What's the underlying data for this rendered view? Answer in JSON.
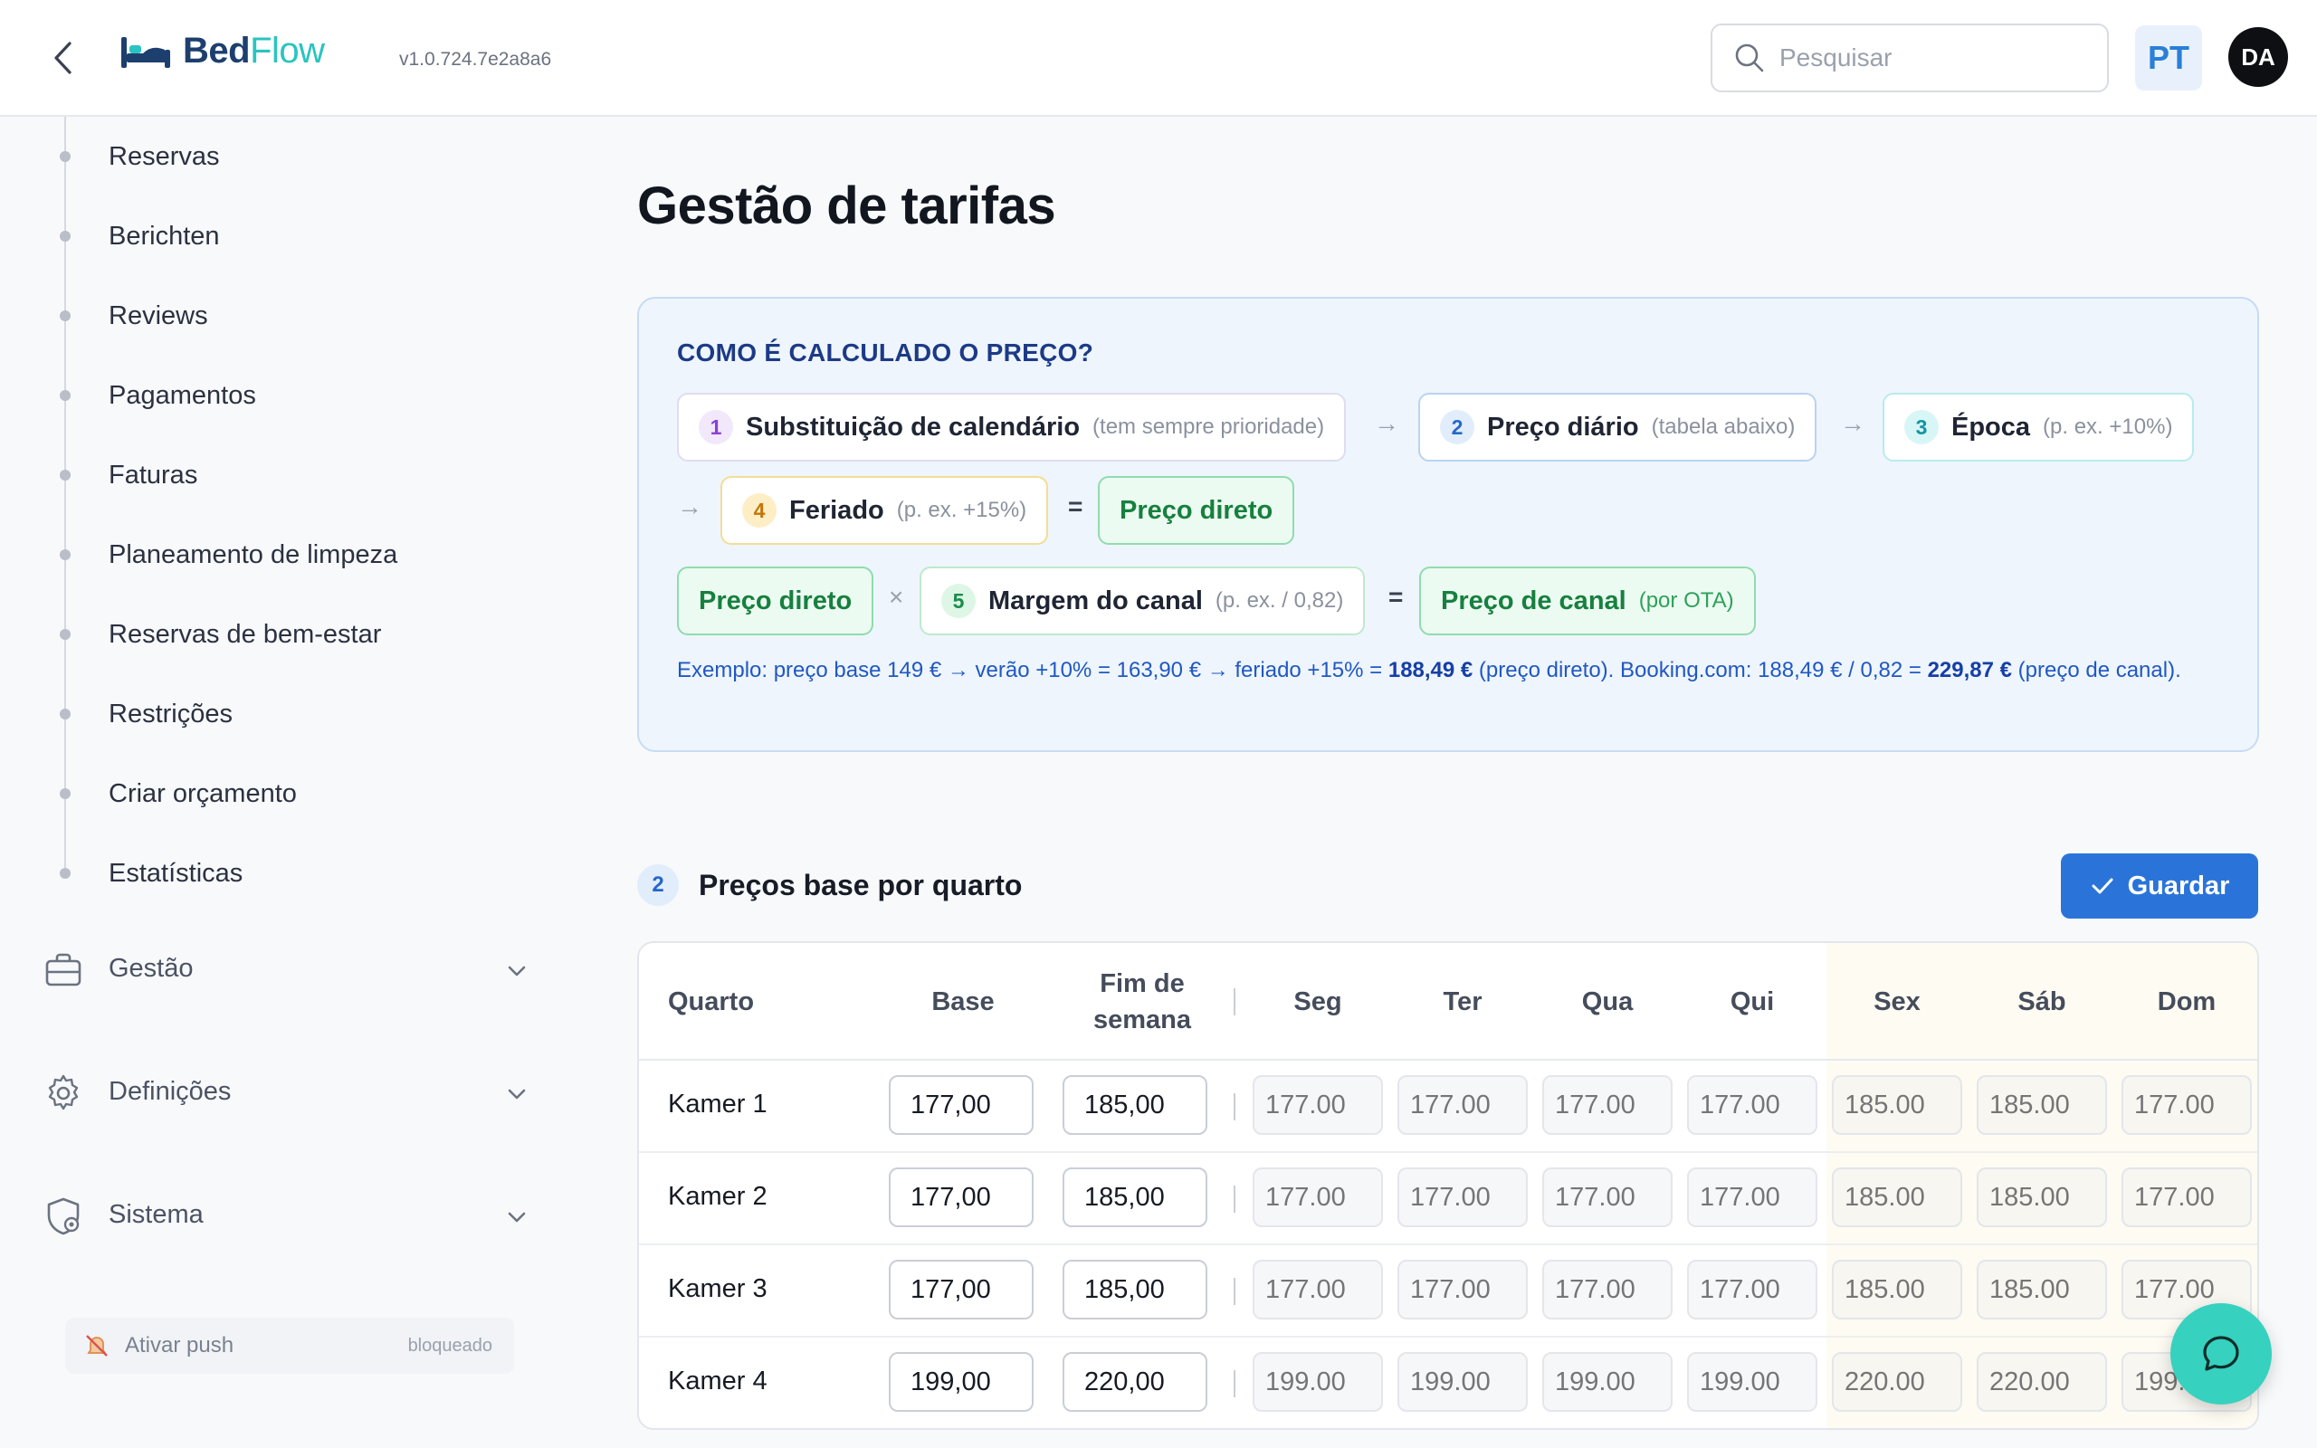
{
  "app": {
    "logo_bed": "Bed",
    "logo_flow": "Flow",
    "version": "v1.0.724.7e2a8a6"
  },
  "header": {
    "search_placeholder": "Pesquisar",
    "lang": "PT",
    "avatar": "DA"
  },
  "sidebar": {
    "items": [
      {
        "label": "Reservas"
      },
      {
        "label": "Berichten"
      },
      {
        "label": "Reviews"
      },
      {
        "label": "Pagamentos"
      },
      {
        "label": "Faturas"
      },
      {
        "label": "Planeamento de limpeza"
      },
      {
        "label": "Reservas de bem-estar"
      },
      {
        "label": "Restrições"
      },
      {
        "label": "Criar orçamento"
      },
      {
        "label": "Estatísticas"
      }
    ],
    "groups": [
      {
        "label": "Gestão",
        "icon": "briefcase-icon"
      },
      {
        "label": "Definições",
        "icon": "gear-icon"
      },
      {
        "label": "Sistema",
        "icon": "shield-gear-icon"
      }
    ],
    "push": {
      "label": "Ativar push",
      "state": "bloqueado"
    }
  },
  "page": {
    "title": "Gestão de tarifas"
  },
  "info": {
    "heading": "COMO É CALCULADO O PREÇO?",
    "steps": [
      {
        "num": "1",
        "name": "Substituição de calendário",
        "hint": "(tem sempre prioridade)"
      },
      {
        "num": "2",
        "name": "Preço diário",
        "hint": "(tabela abaixo)"
      },
      {
        "num": "3",
        "name": "Época",
        "hint": "(p. ex. +10%)"
      },
      {
        "num": "4",
        "name": "Feriado",
        "hint": "(p. ex. +15%)"
      },
      {
        "num": "5",
        "name": "Margem do canal",
        "hint": "(p. ex. / 0,82)"
      }
    ],
    "direct_price": "Preço direto",
    "channel_price": "Preço de canal",
    "channel_hint": "(por OTA)",
    "arrow": "→",
    "equals": "=",
    "times": "×",
    "example_a": "Exemplo: preço base 149 € → verão +10% = 163,90 € → feriado +15% = ",
    "example_b": "188,49 €",
    "example_c": " (preço direto). Booking.com: 188,49 € / 0,82 = ",
    "example_d": "229,87 €",
    "example_e": " (preço de canal)."
  },
  "section": {
    "num": "2",
    "title": "Preços base por quarto",
    "save_label": "Guardar"
  },
  "table": {
    "headers": {
      "room": "Quarto",
      "base": "Base",
      "weekend": "Fim de semana",
      "days": [
        "Seg",
        "Ter",
        "Qua",
        "Qui",
        "Sex",
        "Sáb",
        "Dom"
      ]
    },
    "rows": [
      {
        "room": "Kamer 1",
        "base": "177,00",
        "weekend": "185,00",
        "days": [
          "177.00",
          "177.00",
          "177.00",
          "177.00",
          "185.00",
          "185.00",
          "177.00"
        ]
      },
      {
        "room": "Kamer 2",
        "base": "177,00",
        "weekend": "185,00",
        "days": [
          "177.00",
          "177.00",
          "177.00",
          "177.00",
          "185.00",
          "185.00",
          "177.00"
        ]
      },
      {
        "room": "Kamer 3",
        "base": "177,00",
        "weekend": "185,00",
        "days": [
          "177.00",
          "177.00",
          "177.00",
          "177.00",
          "185.00",
          "185.00",
          "177.00"
        ]
      },
      {
        "room": "Kamer 4",
        "base": "199,00",
        "weekend": "220,00",
        "days": [
          "199.00",
          "199.00",
          "199.00",
          "199.00",
          "220.00",
          "220.00",
          "199.00"
        ]
      }
    ]
  },
  "colors": {
    "accent": "#2a74d9",
    "brand_dark": "#1d3f6e",
    "brand_teal": "#2ac4c0",
    "direct_green": "#17803f",
    "chat": "#36d1bf"
  }
}
